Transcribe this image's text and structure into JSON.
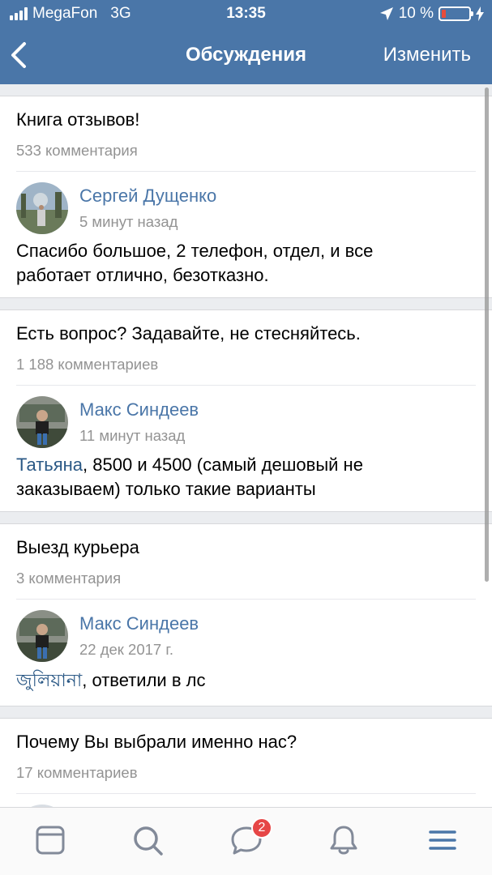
{
  "status": {
    "carrier": "MegaFon",
    "network": "3G",
    "time": "13:35",
    "battery": "10 %"
  },
  "nav": {
    "title": "Обсуждения",
    "edit_label": "Изменить"
  },
  "topics": [
    {
      "title": "Книга отзывов!",
      "count": "533 комментария",
      "author": "Сергей Дущенко",
      "time": "5 минут назад",
      "comment_line1": "Спасибо большое, 2 телефон, отдел, и все",
      "comment_line2": "работает отлично, безотказно."
    },
    {
      "title": "Есть вопрос? Задавайте, не стесняйтесь.",
      "count": "1 188 комментариев",
      "author": "Макс Синдеев",
      "time": "11 минут назад",
      "mention": "Татьяна",
      "comment_line1": ", 8500 и 4500 (самый дешовый не",
      "comment_line2": "заказываем) только такие варианты"
    },
    {
      "title": "Выезд курьера",
      "count": "3 комментария",
      "author": "Макс Синдеев",
      "time": "22 дек 2017 г.",
      "mention": "জুলিয়ানা",
      "comment_line1": ", ответили в лс"
    },
    {
      "title": "Почему Вы выбрали именно нас?",
      "count": "17 комментариев"
    }
  ],
  "tabbar": {
    "messages_badge": "2"
  },
  "colors": {
    "header": "#4a76a8",
    "link": "#4a76a8",
    "badge": "#e64646"
  }
}
